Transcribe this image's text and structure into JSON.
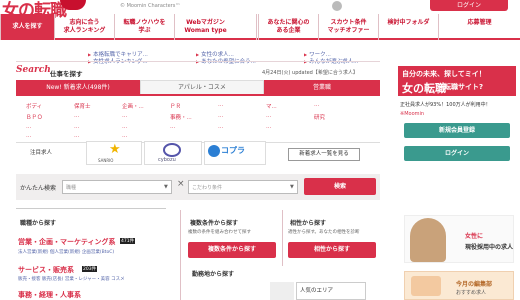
{
  "header": {
    "logo_text": "女の転職",
    "copyright": "© Moomin Characters™",
    "login_label": "ログイン"
  },
  "nav": {
    "search": "求人を探す",
    "ranking": "志向に合う\n求人ランキング",
    "knowhow": "転職ノウハウを\n学ぶ",
    "webmag": "Webマガジン\nWoman type",
    "companies": "あなたに関心の\nある企業",
    "scout": "スカウト条件\nマッチオファー",
    "folder": "検討中フォルダ",
    "apply": "応募管理"
  },
  "news": [
    "本格転職でキャリア...",
    "女性の求人...",
    "ワーク...",
    "女性求人ランキング...",
    "あなたの希望に合う...",
    "みんなが選ぶ求人..."
  ],
  "search": {
    "label": "Search",
    "subtitle": "仕事を探す",
    "updated": "4月24日(火) updated【希望に合う求人】",
    "tabs": [
      "New! 新着求人(498件)",
      "アパレル・コスメ",
      "営業職"
    ],
    "categories": [
      "ボディ",
      "保育士",
      "企画・...",
      "ＰＲ",
      "...",
      "マ...",
      "...",
      "ＢＰＯ",
      "...",
      "...",
      "事務・...",
      "...",
      "...",
      "研究",
      "...",
      "...",
      "...",
      "...",
      "...",
      "...",
      "...",
      "...",
      "..."
    ]
  },
  "featured": {
    "label": "注目求人",
    "star_caption": "SANRIO",
    "cybozu": "cybozu",
    "kopura": "コプラ",
    "view_all": "新着求人一覧を見る"
  },
  "quick_search": {
    "label": "かんたん検索",
    "select1_placeholder": "職種",
    "select2_placeholder": "こだわり条件",
    "button": "検索"
  },
  "job_section": {
    "title": "職種から探す",
    "cat1": "営業・企画・マーケティング系",
    "cat1_count": "471件",
    "cat1_sub": "法人営業(新規) 個人営業(新規) 企画営業(BtoC)",
    "cat2": "サービス・販売系",
    "cat2_count": "203件",
    "cat2_sub": "販売・接客 販売(店長) 営業・レジャー・美容 コスメ",
    "cat3": "事務・経理・人事系"
  },
  "multi_section": {
    "title": "複数条件から探す",
    "desc": "複数の条件を組み合わせて探す",
    "button": "複数条件から探す"
  },
  "affinity_section": {
    "title": "相性から探す",
    "desc": "適性から探す。あなたの相性を診断",
    "button": "相性から探す"
  },
  "area_section": {
    "title": "勤務地から探す",
    "popular": "人気のエリア"
  },
  "sidebar": {
    "banner_line1": "自分の未来、探してミイ！",
    "banner_line2": "女の転職",
    "banner_line2b": "転職サイト?",
    "stats": "正社員求人が93%！100万人が利用中！",
    "note": "※Moomin",
    "register": "新規会員登録",
    "login": "ログイン",
    "ad1_line1": "女性に",
    "ad1_line2": "現役採用中の求人",
    "ad2_line1": "今月の編集部",
    "ad2_line2": "おすすめ求人"
  }
}
